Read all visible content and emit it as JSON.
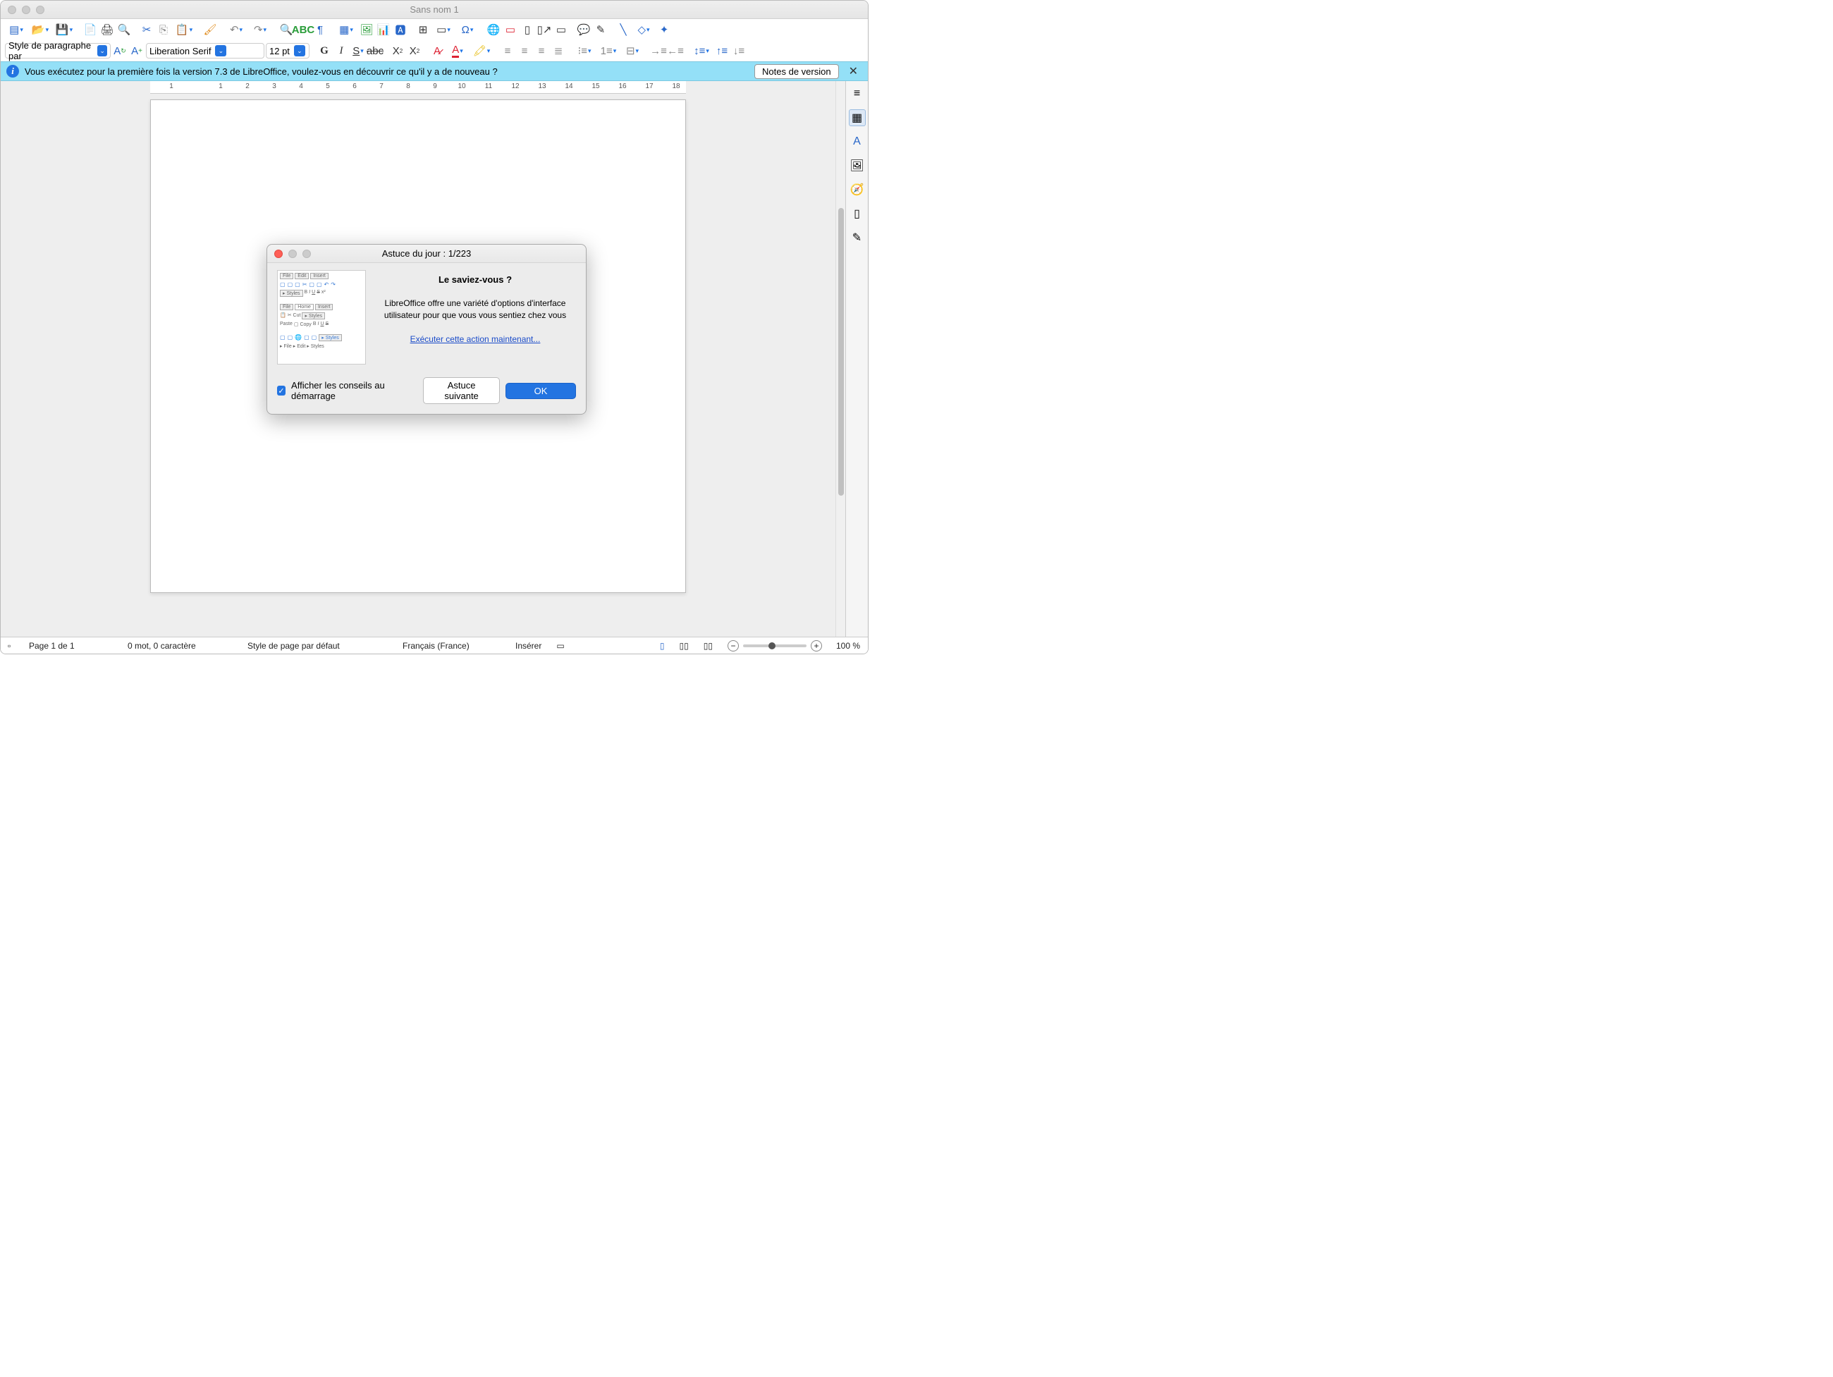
{
  "window": {
    "title": "Sans nom 1"
  },
  "toolbar": {
    "para_style": "Style de paragraphe par",
    "font_name": "Liberation Serif",
    "font_size": "12 pt"
  },
  "infobar": {
    "message": "Vous exécutez pour la première fois la version 7.3 de LibreOffice, voulez-vous en découvrir ce qu'il y a de nouveau ?",
    "button": "Notes de version"
  },
  "ruler": {
    "ticks": [
      "1",
      "",
      "1",
      "2",
      "3",
      "4",
      "5",
      "6",
      "7",
      "8",
      "9",
      "10",
      "11",
      "12",
      "13",
      "14",
      "15",
      "16",
      "17",
      "18"
    ]
  },
  "dialog": {
    "title": "Astuce du jour : 1/223",
    "heading": "Le saviez-vous ?",
    "body": "LibreOffice offre une variété d'options d'interface utilisateur pour que vous vous sentiez chez vous",
    "link": "Exécuter cette action maintenant...",
    "checkbox_label": "Afficher les conseils au démarrage",
    "next_button": "Astuce suivante",
    "ok_button": "OK",
    "img_tabs": {
      "file": "File",
      "edit": "Edit",
      "insert": "Insert",
      "home": "Home",
      "styles": "Styles",
      "cut": "Cut",
      "paste": "Paste",
      "copy": "Copy"
    }
  },
  "statusbar": {
    "page": "Page 1 de 1",
    "words": "0 mot, 0 caractère",
    "page_style": "Style de page par défaut",
    "lang": "Français (France)",
    "insert": "Insérer",
    "zoom": "100 %"
  }
}
